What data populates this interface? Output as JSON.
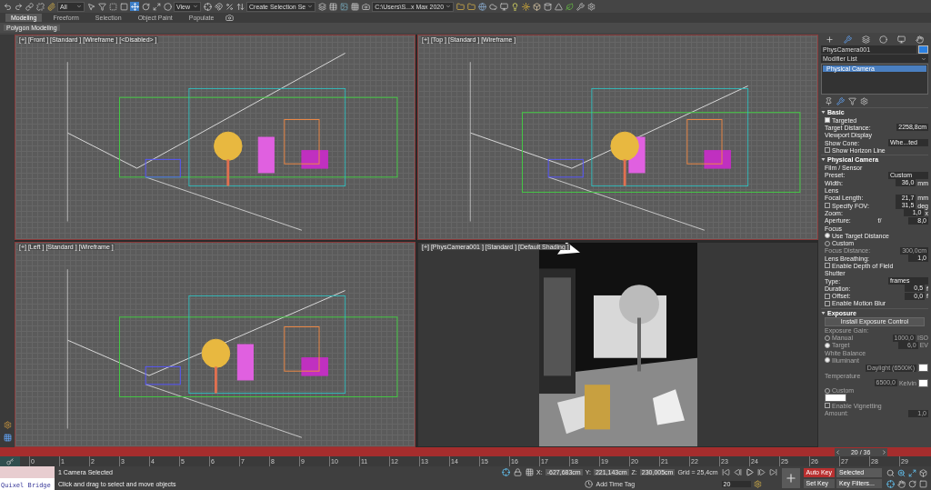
{
  "toolbar": {
    "selection_filter": "All",
    "reference_coord": "View",
    "selection_set": "Create Selection Se",
    "workspace": "C:\\Users\\S...x Max 2020"
  },
  "ribbon": {
    "tabs": [
      {
        "label": "Modeling",
        "selected": true
      },
      {
        "label": "Freeform",
        "selected": false
      },
      {
        "label": "Selection",
        "selected": false
      },
      {
        "label": "Object Paint",
        "selected": false
      },
      {
        "label": "Populate",
        "selected": false
      }
    ],
    "panel": "Polygon Modeling"
  },
  "viewports": [
    {
      "label": "[+] [Front ] [Standard ] [Wireframe ] [<Disabled> ]",
      "kind": "wireframe"
    },
    {
      "label": "[+] [Top ] [Standard ] [Wireframe ]",
      "kind": "wireframe"
    },
    {
      "label": "[+] [Left ] [Standard ] [Wireframe ]",
      "kind": "wireframe"
    },
    {
      "label": "[+] [PhysCamera001 ] [Standard ] [Default Shading ]",
      "kind": "render"
    }
  ],
  "command_panel": {
    "object_name": "PhysCamera001",
    "modifier_list": "Modifier List",
    "stack": [
      {
        "label": "Physical Camera",
        "selected": true
      }
    ],
    "rollouts": [
      {
        "title": "Basic",
        "rows": [
          {
            "kind": "check",
            "label": "Targeted",
            "checked": true,
            "disabled": false
          },
          {
            "kind": "spinner",
            "label": "Target Distance:",
            "value": "2258,8cm",
            "disabled": false
          },
          {
            "kind": "heading",
            "label": "Viewport Display",
            "disabled": false
          },
          {
            "kind": "dropdown",
            "label": "Show Cone:",
            "value": "Whe...ted",
            "disabled": false
          },
          {
            "kind": "check",
            "label": "Show Horizon Line",
            "checked": false,
            "disabled": false
          }
        ]
      },
      {
        "title": "Physical Camera",
        "rows": [
          {
            "kind": "heading",
            "label": "Film / Sensor",
            "disabled": false
          },
          {
            "kind": "dropdown",
            "label": "Preset:",
            "value": "Custom",
            "disabled": false
          },
          {
            "kind": "spinner",
            "label": "Width:",
            "value": "36,0",
            "unit": "mm",
            "disabled": false
          },
          {
            "kind": "heading",
            "label": "Lens",
            "disabled": false
          },
          {
            "kind": "spinner",
            "label": "Focal Length:",
            "value": "21,7",
            "unit": "mm",
            "disabled": false
          },
          {
            "kind": "check",
            "label": "Specify FOV:",
            "checked": false,
            "value": "31,5",
            "unit": "deg",
            "disabled": false
          },
          {
            "kind": "spinner",
            "label": "Zoom:",
            "value": "1,0",
            "unit": "x",
            "disabled": false
          },
          {
            "kind": "spinner",
            "label": "Aperture:",
            "prefix": "f/",
            "value": "8,0",
            "disabled": false
          },
          {
            "kind": "heading",
            "label": "Focus",
            "disabled": false
          },
          {
            "kind": "radio",
            "label": "Use Target Distance",
            "selected": true,
            "disabled": false
          },
          {
            "kind": "radio",
            "label": "Custom",
            "selected": false,
            "disabled": false
          },
          {
            "kind": "spinner",
            "label": "Focus Distance:",
            "value": "300,0cm",
            "disabled": true
          },
          {
            "kind": "spinner",
            "label": "Lens Breathing:",
            "value": "1,0",
            "disabled": false
          },
          {
            "kind": "check",
            "label": "Enable Depth of Field",
            "checked": false,
            "disabled": false
          },
          {
            "kind": "heading",
            "label": "Shutter",
            "disabled": false
          },
          {
            "kind": "dropdown",
            "label": "Type:",
            "value": "frames",
            "disabled": false
          },
          {
            "kind": "spinner",
            "label": "Duration:",
            "value": "0,5",
            "unit": "f",
            "disabled": false
          },
          {
            "kind": "check",
            "label": "Offset:",
            "checked": false,
            "value": "0,0",
            "unit": "f",
            "disabled": false
          },
          {
            "kind": "check",
            "label": "Enable Motion Blur",
            "checked": false,
            "disabled": false
          }
        ]
      },
      {
        "title": "Exposure",
        "rows": [
          {
            "kind": "button",
            "label": "Install Exposure Control",
            "disabled": false
          },
          {
            "kind": "heading",
            "label": "Exposure Gain:",
            "disabled": true
          },
          {
            "kind": "radio",
            "label": "Manual",
            "selected": false,
            "value": "1000,0",
            "unit": "ISO",
            "disabled": true
          },
          {
            "kind": "radio",
            "label": "Target",
            "selected": true,
            "value": "6,0",
            "unit": "EV",
            "disabled": true
          },
          {
            "kind": "heading",
            "label": "White Balance",
            "disabled": true
          },
          {
            "kind": "radio",
            "label": "Illuminant",
            "selected": true,
            "disabled": true
          },
          {
            "kind": "dropdown",
            "value": "Daylight (6500K)",
            "color": "#ffffff",
            "disabled": true
          },
          {
            "kind": "heading",
            "label": "Temperature",
            "disabled": true
          },
          {
            "kind": "spinner",
            "value": "6500,0",
            "unit": "Kelvin",
            "color": "#ffffff",
            "disabled": true
          },
          {
            "kind": "radio",
            "label": "Custom",
            "selected": false,
            "disabled": true
          },
          {
            "kind": "swatch",
            "color": "#ffffff",
            "disabled": true
          },
          {
            "kind": "check",
            "label": "Enable Vignetting",
            "checked": false,
            "disabled": true
          },
          {
            "kind": "spinner",
            "label": "Amount:",
            "value": "1,0",
            "disabled": true
          }
        ]
      }
    ]
  },
  "time_slider": {
    "label": "20 / 36",
    "level": 0.95
  },
  "track_ticks": [
    "0",
    "1",
    "2",
    "3",
    "4",
    "5",
    "6",
    "7",
    "8",
    "9",
    "10",
    "11",
    "12",
    "13",
    "14",
    "15",
    "16",
    "17",
    "18",
    "19",
    "20",
    "21",
    "22",
    "23",
    "24",
    "25",
    "26",
    "27",
    "28",
    "29"
  ],
  "status_bar": {
    "bridge": "Quixel Bridge",
    "prompt": [
      "1 Camera Selected",
      "Click and drag to select and move objects"
    ],
    "coords": [
      {
        "axis": "X:",
        "value": "-627,683cm"
      },
      {
        "axis": "Y:",
        "value": "221,143cm"
      },
      {
        "axis": "Z:",
        "value": "230,005cm"
      }
    ],
    "grid": "Grid = 25,4cm",
    "time_tag": "Add Time Tag",
    "frame": "20",
    "auto_key": {
      "label": "Auto Key",
      "on": true
    },
    "key_mode": "Selected",
    "set_key": "Set Key",
    "key_filters": "Key Filters..."
  }
}
